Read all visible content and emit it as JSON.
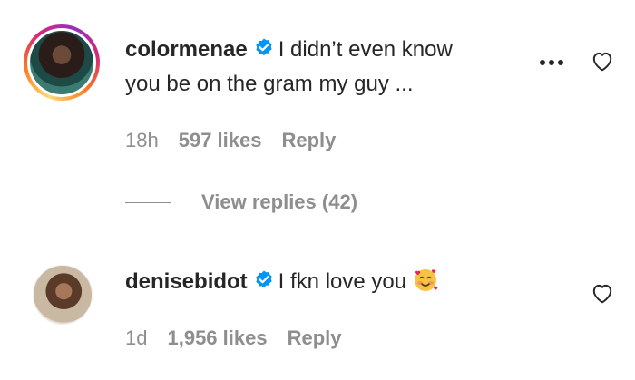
{
  "comments": [
    {
      "username": "colormenae",
      "text_line1": "I didn’t even know",
      "text_line2": "you be on the gram my guy ...",
      "time": "18h",
      "likes": "597 likes",
      "reply": "Reply",
      "more_icon": "more-horizontal-icon",
      "like_icon": "heart-outline-icon"
    },
    {
      "username": "denisebidot",
      "text": "I fkn love you",
      "emoji": "smiling-face-with-hearts-icon",
      "time": "1d",
      "likes": "1,956 likes",
      "reply": "Reply",
      "like_icon": "heart-outline-icon"
    }
  ],
  "view_replies": {
    "label": "View replies (42)"
  },
  "colors": {
    "text": "#262626",
    "secondary": "#8e8e8e",
    "verified": "#0095f6"
  }
}
